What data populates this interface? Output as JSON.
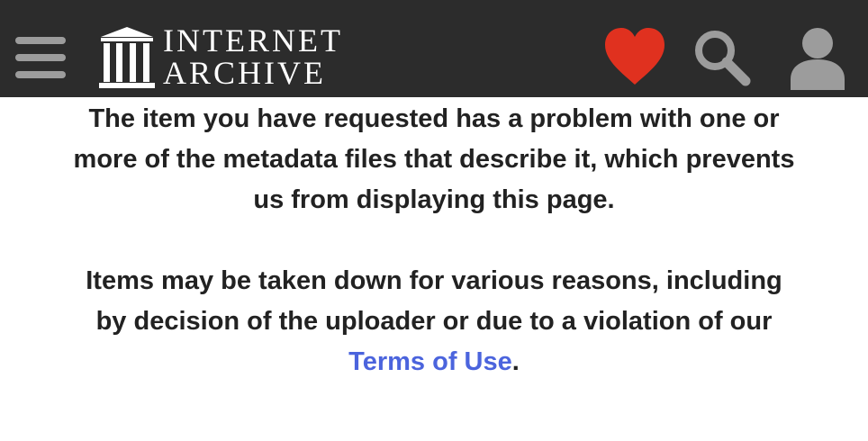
{
  "header": {
    "logo_line1": "INTERNET",
    "logo_line2": "ARCHIVE",
    "icons": [
      "menu-icon",
      "internet-archive-logo-icon",
      "heart-icon",
      "search-icon",
      "user-icon"
    ],
    "colors": {
      "background": "#2c2c2c",
      "icon_gray": "#9c9c9c",
      "heart": "#e0311f",
      "logo": "#ffffff"
    }
  },
  "message": {
    "paragraph1": "The item you have requested has a problem with one or more of the metadata files that describe it, which prevents us from displaying this page.",
    "paragraph2_text": "Items may be taken down for various reasons, including by decision of the uploader or due to a violation of our ",
    "link_label": "Terms of Use",
    "paragraph2_end": ".",
    "colors": {
      "text": "#222222",
      "link": "#4b64dd"
    }
  }
}
